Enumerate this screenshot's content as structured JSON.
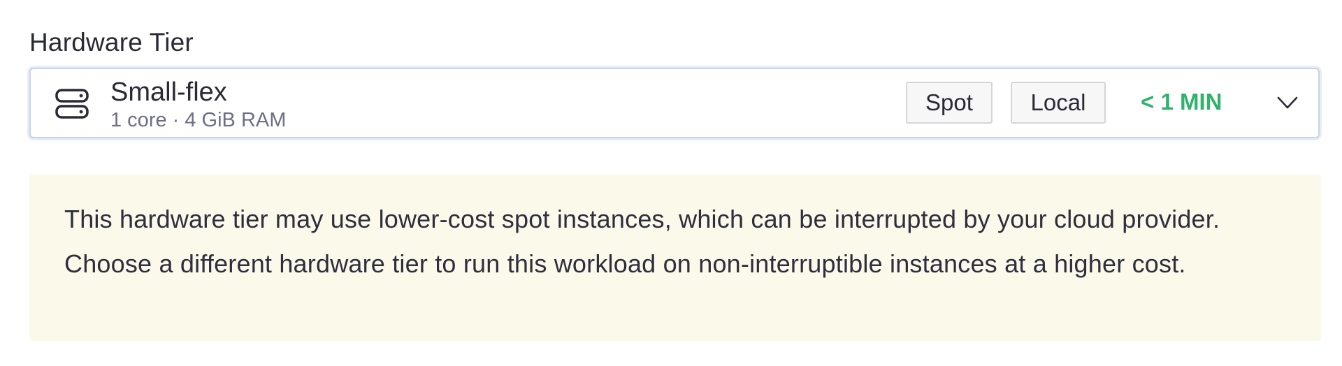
{
  "field": {
    "label": "Hardware Tier"
  },
  "selected_tier": {
    "name": "Small-flex",
    "spec": "1 core · 4 GiB RAM",
    "icon": "server-icon",
    "badges": [
      "Spot",
      "Local"
    ],
    "startup_time": "< 1 MIN",
    "startup_color": "#2fb36a"
  },
  "notice": {
    "text": "This hardware tier may use lower-cost spot instances, which can be interrupted by your cloud provider. Choose a different hardware tier to run this workload on non-interruptible instances at a higher cost.",
    "background": "#fbf9ea"
  }
}
